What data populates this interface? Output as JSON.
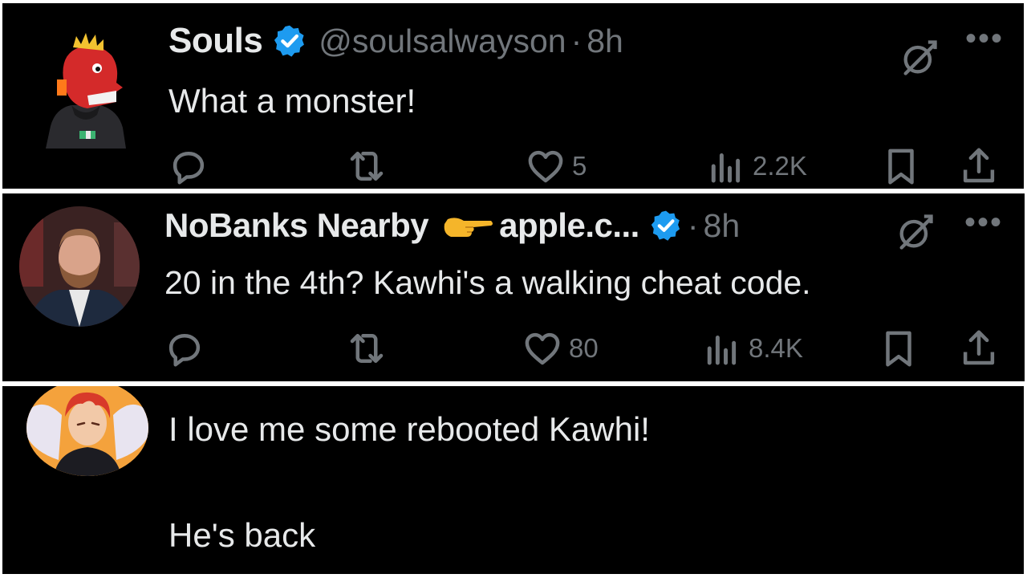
{
  "posts": [
    {
      "name": "Souls",
      "handle": "@soulsalwayson",
      "separator": "·",
      "time": "8h",
      "text": "What a monster!",
      "stats": {
        "replies": "",
        "reposts": "",
        "likes": "5",
        "views": "2.2K"
      },
      "avatar_icon": "red-dragon-avatar"
    },
    {
      "name": "NoBanks Nearby",
      "name_suffix": "apple.c...",
      "emoji_icon": "pointing-finger-emoji",
      "separator": "·",
      "time": "8h",
      "text": "20 in the 4th? Kawhi's a walking cheat code.",
      "stats": {
        "replies": "",
        "reposts": "",
        "likes": "80",
        "views": "8.4K"
      },
      "avatar_icon": "bearded-man-avatar"
    },
    {
      "text_line1": "I love me some rebooted Kawhi!",
      "text_line2": "He's back",
      "avatar_icon": "anime-winged-avatar"
    }
  ],
  "colors": {
    "background": "#000000",
    "primary_text": "#e7e9ea",
    "secondary_text": "#71767b",
    "verified_blue": "#1d9bf0"
  },
  "icons": [
    "reply-icon",
    "repost-icon",
    "like-icon",
    "views-icon",
    "bookmark-icon",
    "share-icon",
    "grok-icon",
    "more-icon",
    "verified-badge-icon"
  ]
}
